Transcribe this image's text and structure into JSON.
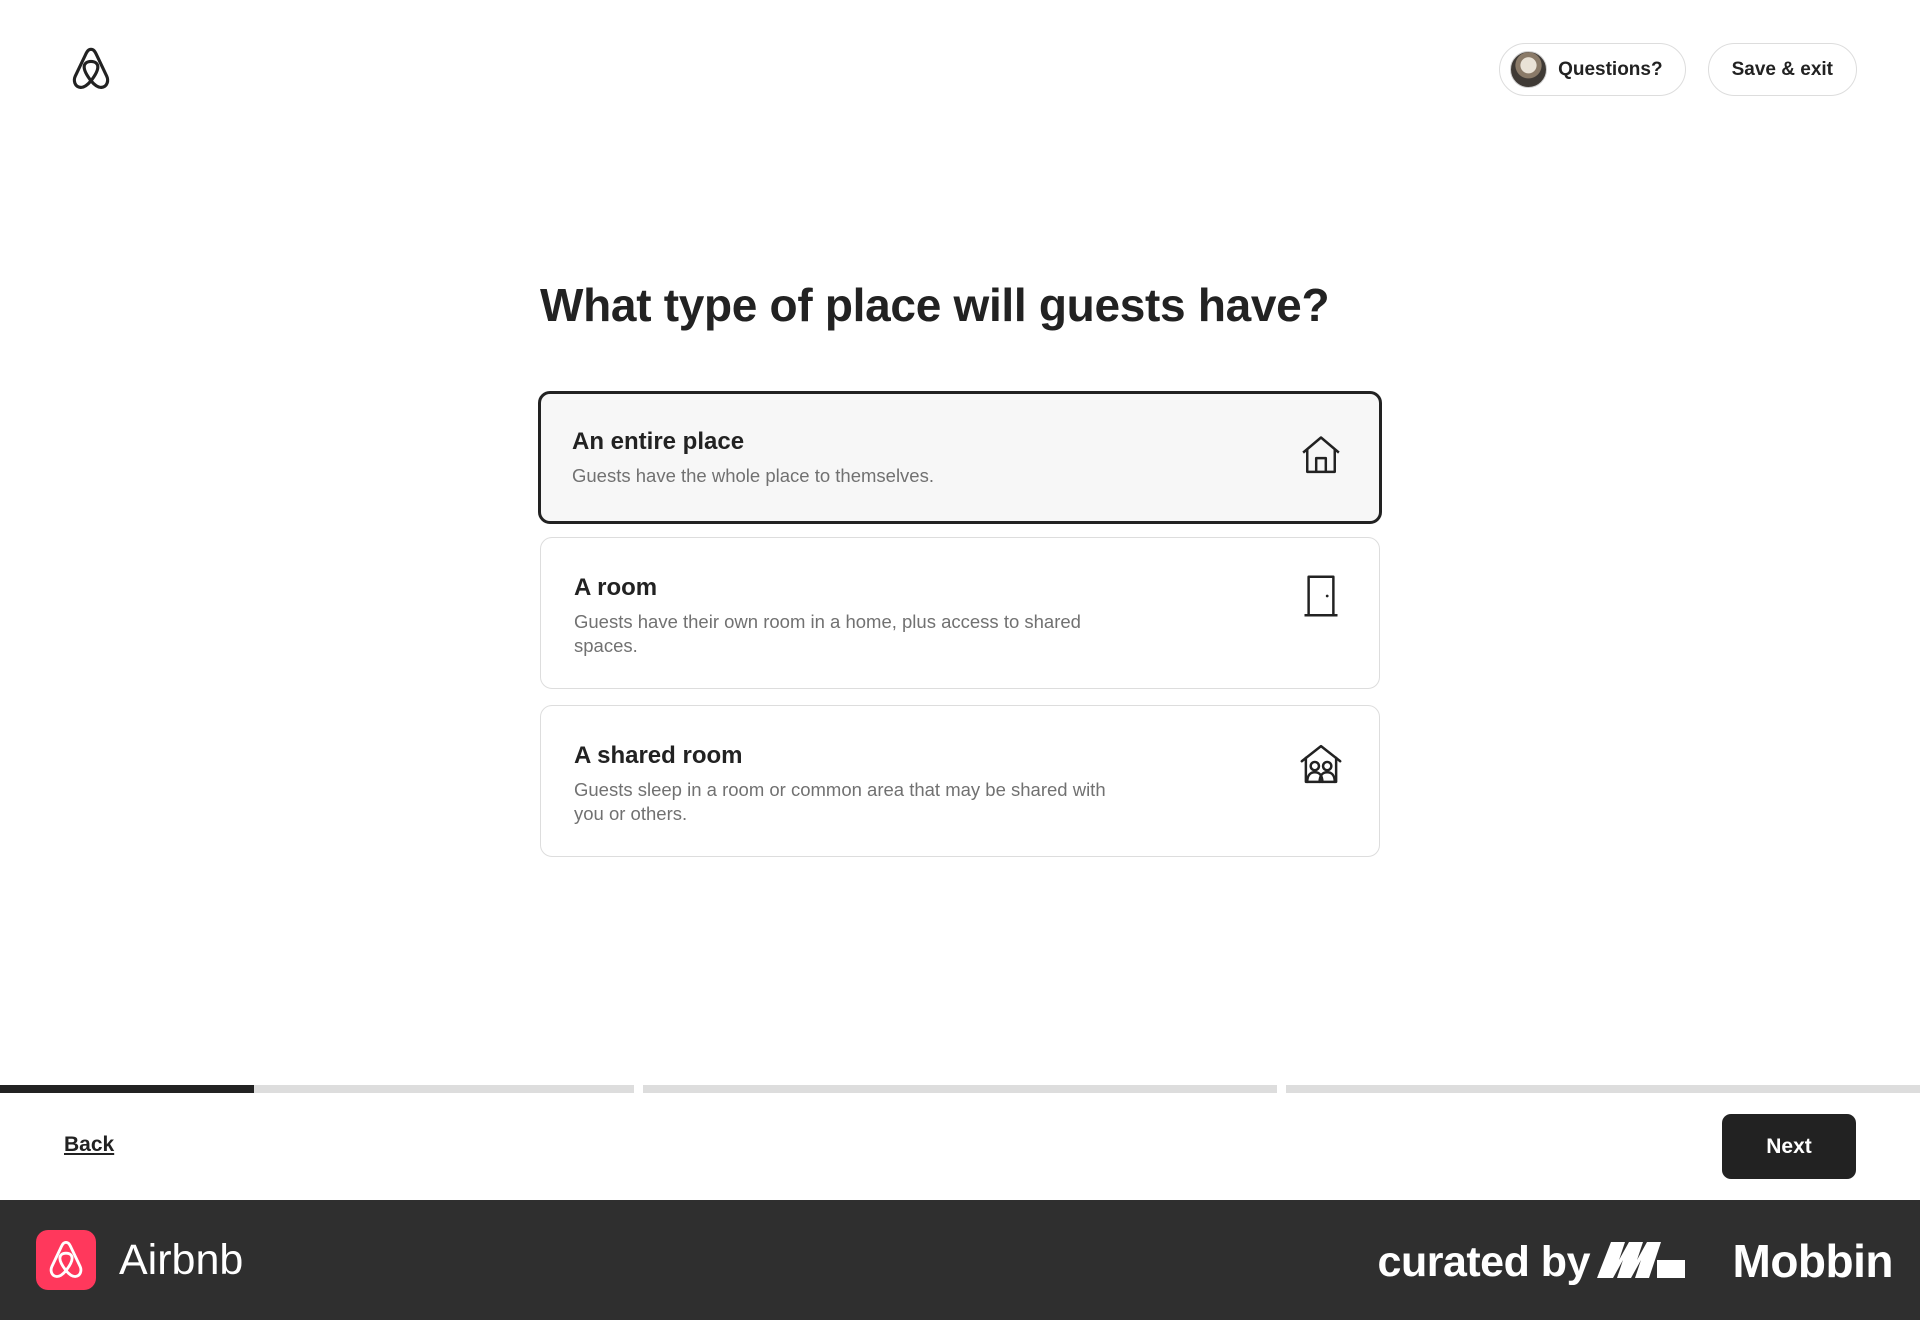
{
  "header": {
    "logo_icon": "airbnb-logo-icon",
    "questions_label": "Questions?",
    "save_exit_label": "Save & exit"
  },
  "main": {
    "title": "What type of place will guests have?",
    "options": [
      {
        "title": "An entire place",
        "description": "Guests have the whole place to themselves.",
        "icon": "house-icon",
        "selected": true
      },
      {
        "title": "A room",
        "description": "Guests have their own room in a home, plus access to shared spaces.",
        "icon": "door-icon",
        "selected": false
      },
      {
        "title": "A shared room",
        "description": "Guests sleep in a room or common area that may be shared with you or others.",
        "icon": "shared-room-icon",
        "selected": false
      }
    ]
  },
  "progress": {
    "steps": 3,
    "current_step": 1,
    "step1_fraction": 0.4
  },
  "footer": {
    "back_label": "Back",
    "next_label": "Next"
  },
  "branding": {
    "app_name": "Airbnb",
    "curated_by": "curated by",
    "curator_name": "Mobbin",
    "accent_color": "#ff385c"
  }
}
